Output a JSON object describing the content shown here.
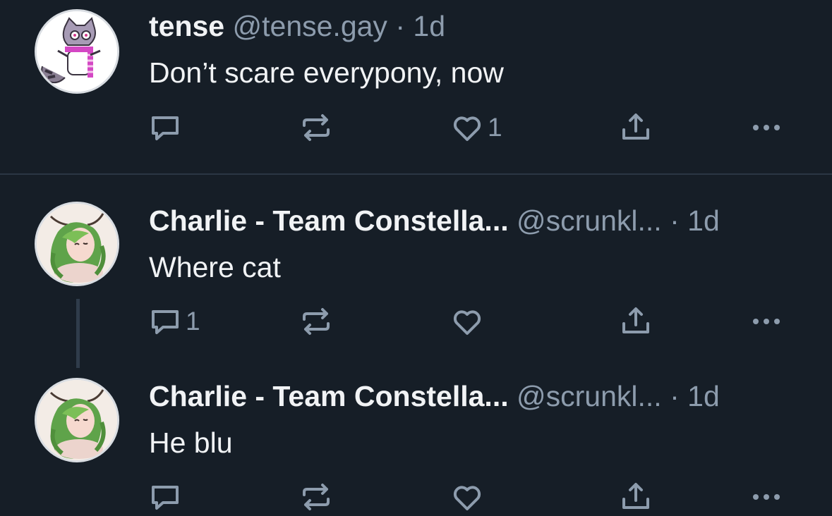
{
  "posts": [
    {
      "name": "tense",
      "handle": "@tense.gay",
      "dot": "·",
      "time": "1d",
      "text": "Don’t scare everypony, now",
      "reply_count": "",
      "repost_count": "",
      "like_count": "1",
      "avatar": "raccoon-avatar"
    },
    {
      "name": "Charlie - Team Constella...",
      "handle": "@scrunkl...",
      "dot": "·",
      "time": "1d",
      "text": "Where cat",
      "reply_count": "1",
      "repost_count": "",
      "like_count": "",
      "avatar": "green-hair-avatar"
    },
    {
      "name": "Charlie - Team Constella...",
      "handle": "@scrunkl...",
      "dot": "·",
      "time": "1d",
      "text": "He blu",
      "reply_count": "",
      "repost_count": "",
      "like_count": "",
      "avatar": "green-hair-avatar"
    }
  ],
  "icons": {
    "reply": "reply-icon",
    "repost": "repost-icon",
    "like": "heart-icon",
    "share": "share-icon",
    "more": "more-icon"
  },
  "colors": {
    "background": "#161e27",
    "text": "#f1f3f5",
    "muted": "#8d9cad",
    "divider": "#2b3644"
  }
}
